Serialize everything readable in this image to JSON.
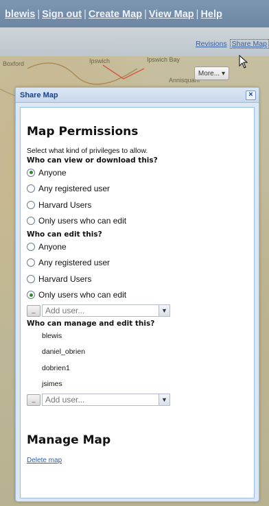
{
  "topnav": {
    "links": [
      "blewis",
      "Sign out",
      "Create Map",
      "View Map",
      "Help"
    ],
    "separator": "|"
  },
  "toolbar": {
    "revisions_link": "Revisions",
    "share_link": "Share Map",
    "more_button": "More..."
  },
  "map_labels": [
    "Boxford",
    "Ipswich",
    "Ipswich Bay",
    "Annisquam"
  ],
  "dialog": {
    "title": "Share Map",
    "close_label": "×",
    "permissions_heading": "Map Permissions",
    "intro": "Select what kind of privileges to allow.",
    "view_section": {
      "question": "Who can view or download this?",
      "options": [
        "Anyone",
        "Any registered user",
        "Harvard Users",
        "Only users who can edit"
      ],
      "selected": "Anyone"
    },
    "edit_section": {
      "question": "Who can edit this?",
      "options": [
        "Anyone",
        "Any registered user",
        "Harvard Users",
        "Only users who can edit"
      ],
      "selected": "Only users who can edit",
      "add_user_placeholder": "Add user..."
    },
    "manage_section": {
      "question": "Who can manage and edit this?",
      "users": [
        "blewis",
        "daniel_obrien",
        "dobrien1",
        "jsimes"
      ],
      "add_user_placeholder": "Add user..."
    },
    "manage_heading": "Manage Map",
    "delete_link": "Delete map"
  }
}
